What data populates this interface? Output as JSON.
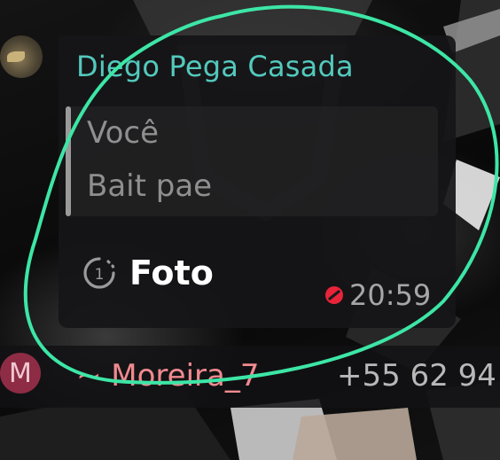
{
  "message": {
    "sender_name": "Diego Pega Casada",
    "sender_color": "#53c9bd",
    "quote": {
      "author": "Você",
      "text": "Bait pae"
    },
    "media_icon": "view-once-icon",
    "media_label": "Foto",
    "status_icon": "blocked-icon",
    "time": "20:59"
  },
  "next_message": {
    "avatar_letter": "M",
    "sender_name": "~ Moreira_7",
    "sender_color": "#f08a8f",
    "phone": "+55 62 94"
  },
  "annotation": {
    "color": "#3de6a6"
  }
}
